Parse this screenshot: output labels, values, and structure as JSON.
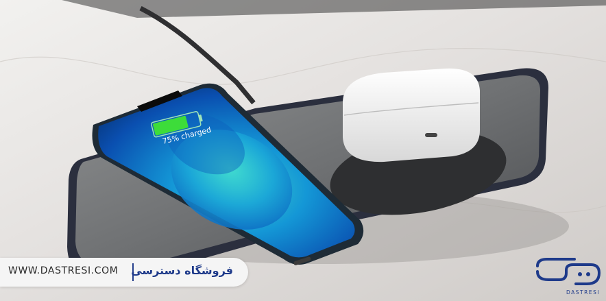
{
  "screen": {
    "charge_text": "75% charged",
    "charge_level": 0.75
  },
  "footer": {
    "website": "WWW.DASTRESI.COM",
    "store_name": "فروشگاه دسترسی"
  },
  "logo": {
    "wordmark": "DASTRESI"
  },
  "colors": {
    "brand_blue": "#1e3a8a",
    "battery_green": "#3ddc3a",
    "phone_screen_blue": "#0d63c9",
    "pad_dark": "#2b2f3e"
  }
}
